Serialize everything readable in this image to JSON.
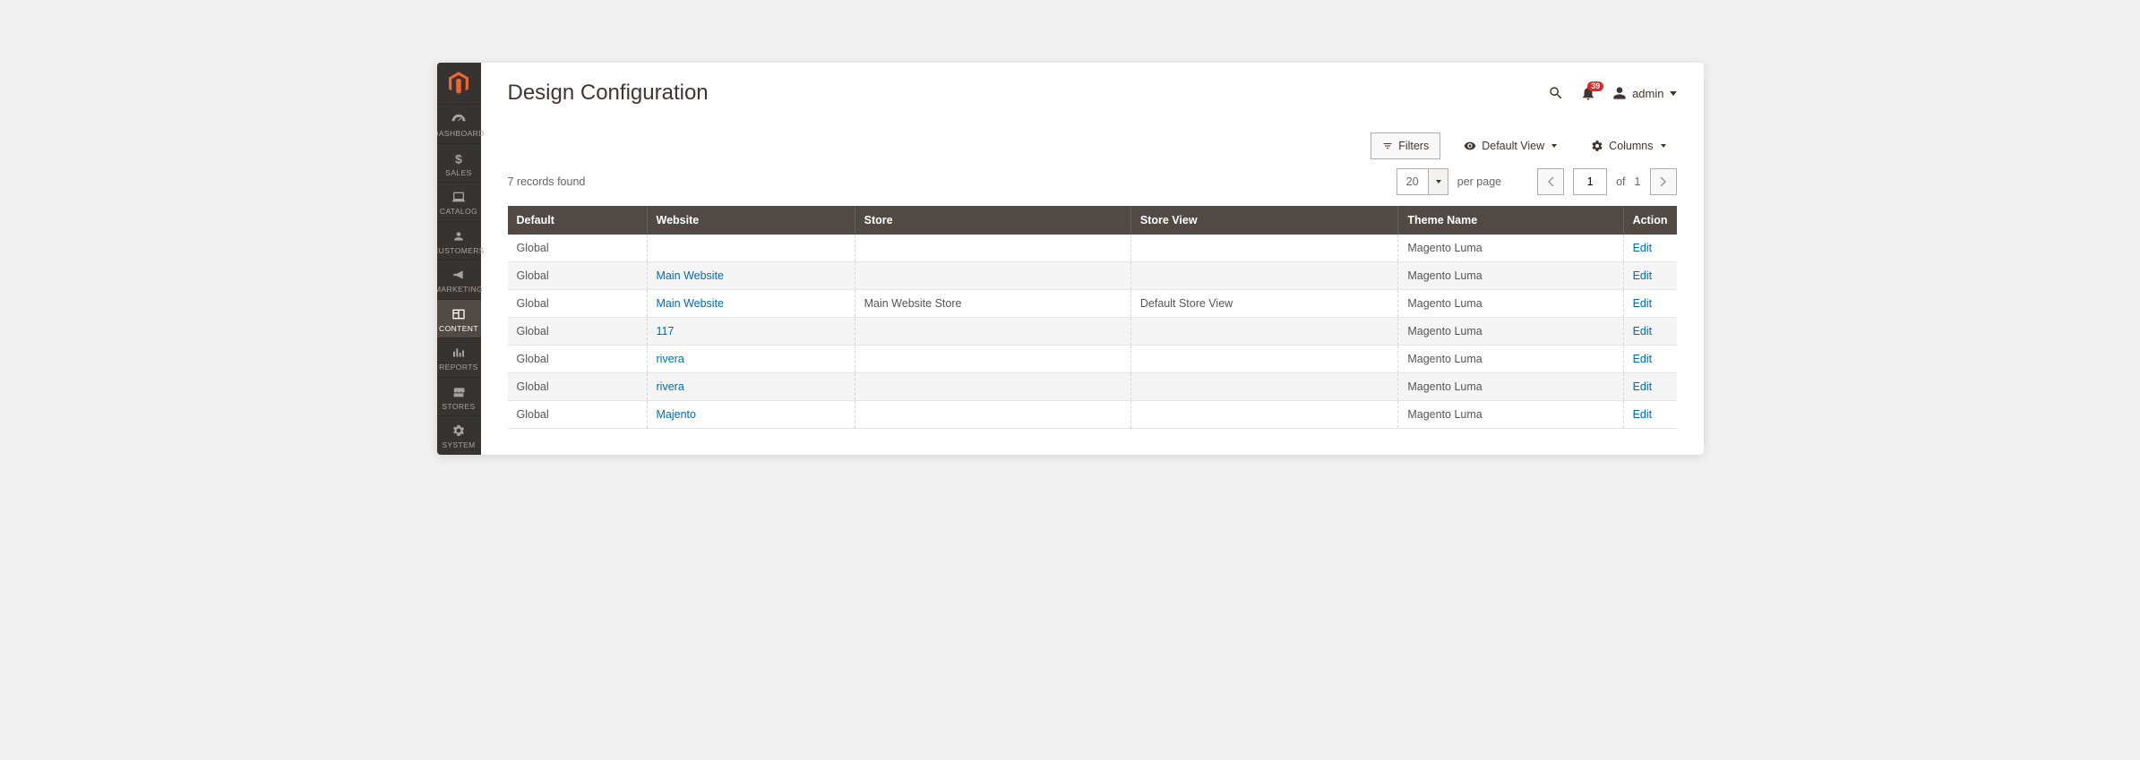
{
  "sidebar": {
    "items": [
      {
        "key": "dashboard",
        "label": "DASHBOARD"
      },
      {
        "key": "sales",
        "label": "SALES"
      },
      {
        "key": "catalog",
        "label": "CATALOG"
      },
      {
        "key": "customers",
        "label": "CUSTOMERS"
      },
      {
        "key": "marketing",
        "label": "MARKETING"
      },
      {
        "key": "content",
        "label": "CONTENT",
        "active": true
      },
      {
        "key": "reports",
        "label": "REPORTS"
      },
      {
        "key": "stores",
        "label": "STORES"
      },
      {
        "key": "system",
        "label": "SYSTEM"
      }
    ]
  },
  "header": {
    "title": "Design Configuration",
    "notif_count": "39",
    "admin_label": "admin"
  },
  "toolbar": {
    "filters_label": "Filters",
    "default_view_label": "Default View",
    "columns_label": "Columns"
  },
  "pager": {
    "records_text": "7 records found",
    "page_size": "20",
    "per_page_label": "per page",
    "current_page": "1",
    "of_label": "of",
    "total_pages": "1"
  },
  "table": {
    "headers": {
      "default": "Default",
      "website": "Website",
      "store": "Store",
      "store_view": "Store View",
      "theme": "Theme Name",
      "action": "Action"
    },
    "action_label": "Edit",
    "rows": [
      {
        "default": "Global",
        "website": "",
        "website_link": false,
        "store": "",
        "store_view": "",
        "theme": "Magento Luma"
      },
      {
        "default": "Global",
        "website": "Main Website",
        "website_link": true,
        "store": "",
        "store_view": "",
        "theme": "Magento Luma"
      },
      {
        "default": "Global",
        "website": "Main Website",
        "website_link": true,
        "store": "Main Website Store",
        "store_view": "Default Store View",
        "theme": "Magento Luma"
      },
      {
        "default": "Global",
        "website": "117",
        "website_link": true,
        "store": "",
        "store_view": "",
        "theme": "Magento Luma"
      },
      {
        "default": "Global",
        "website": "rivera",
        "website_link": true,
        "store": "",
        "store_view": "",
        "theme": "Magento Luma"
      },
      {
        "default": "Global",
        "website": "rivera",
        "website_link": true,
        "store": "",
        "store_view": "",
        "theme": "Magento Luma"
      },
      {
        "default": "Global",
        "website": "Majento",
        "website_link": true,
        "store": "",
        "store_view": "",
        "theme": "Magento Luma"
      }
    ]
  }
}
